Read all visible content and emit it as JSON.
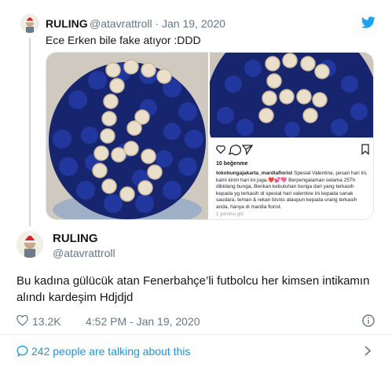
{
  "quoted": {
    "name": "RULING",
    "handle": "@atavrattroll",
    "separator": "·",
    "date": "Jan 19, 2020",
    "handle_line": "@atavrattroll · Jan 19, 2020",
    "text": "Ece Erken bile fake atıyor :DDD"
  },
  "instagram": {
    "likes": "10 beğenme",
    "caption_user": "tokobungajakarta_mardiaflorist",
    "caption": "Spesial Valentine, pesan hari ini, kami kirim hari ini juga.❤️💕💖 Berpengalaman selama 25Th dibidang bunga, Berikan kebutuhan bunga dari yang terkasih kepada yg terkasih di spesial hari valentine ini kepada sanak saudara, teman & rekan bisnis ataupun kepada orang terkasih anda, hanya di mardia florist.",
    "comments": "1 yorumu gör"
  },
  "main": {
    "name": "RULING",
    "handle": "@atavrattroll",
    "text": "Bu kadına gülücük atan Fenerbahçe’li futbolcu her kimsen intikamın alındı kardeşim Hdjdjd",
    "likes": "13.2K",
    "time": "4:52 PM - Jan 19, 2020"
  },
  "footer": {
    "talking": "242 people are talking about this"
  },
  "colors": {
    "accent": "#1b95e0",
    "twitter_blue": "#1da1f2",
    "muted": "#657786",
    "rose_blue": "#1c2f8f",
    "rose_cream": "#e8dcc6"
  },
  "icons": [
    "twitter-bird-icon",
    "heart-icon",
    "info-icon",
    "speech-bubble-icon",
    "chevron-right-icon"
  ]
}
